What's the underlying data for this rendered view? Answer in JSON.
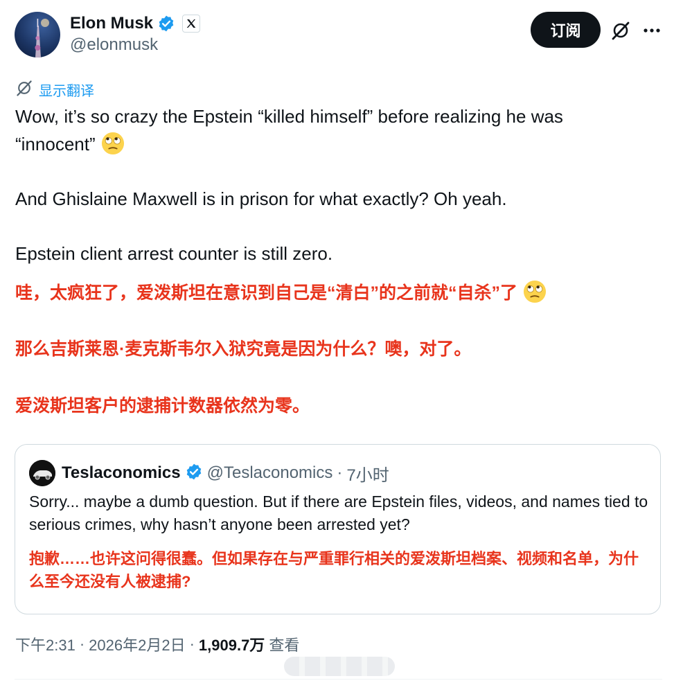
{
  "author": {
    "display_name": "Elon Musk",
    "handle": "@elonmusk",
    "verified": true,
    "affiliate_badge": "x-logo-icon"
  },
  "actions": {
    "subscribe_label": "订阅"
  },
  "translate": {
    "label": "显示翻译"
  },
  "post": {
    "en_lines": [
      "Wow, it’s so crazy the Epstein “killed himself” before realizing he was",
      "“innocent”",
      "And Ghislaine Maxwell is in prison for what exactly? Oh yeah.",
      "Epstein client arrest counter is still zero."
    ],
    "zh_lines": [
      "哇，太疯狂了，爱泼斯坦在意识到自己是“清白”的之前就“自杀”了",
      "那么吉斯莱恩·麦克斯韦尔入狱究竟是因为什么？噢，对了。",
      "爱泼斯坦客户的逮捕计数器依然为零。"
    ],
    "emoji": "face-with-rolling-eyes"
  },
  "quote": {
    "display_name": "Teslaconomics",
    "handle": "@Teslaconomics",
    "separator": "·",
    "time": "7小时",
    "en_text": "Sorry... maybe a dumb question. But if there are Epstein files, videos, and names tied to serious crimes, why hasn’t anyone been arrested yet?",
    "zh_text": "抱歉……也许这问得很蠢。但如果存在与严重罪行相关的爱泼斯坦档案、视频和名单，为什么至今还没有人被逮捕?"
  },
  "meta": {
    "time": "下午2:31",
    "sep1": "·",
    "date": "2026年2月2日",
    "sep2": "·",
    "views_count": "1,909.7万",
    "views_label": "查看"
  },
  "colors": {
    "accent": "#1d9bf0",
    "translation_red": "#e8341c",
    "text_primary": "#0f1419",
    "text_secondary": "#536471",
    "border": "#cfd9de"
  }
}
